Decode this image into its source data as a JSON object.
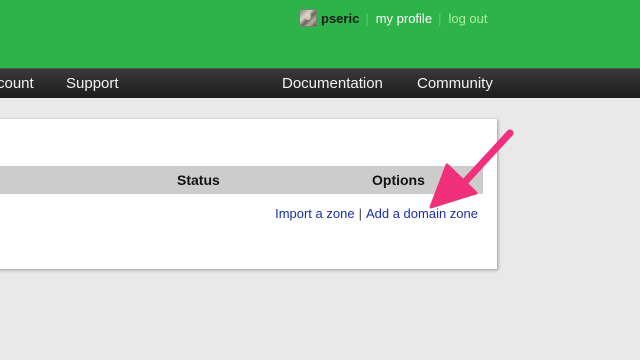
{
  "header": {
    "username": "pseric",
    "links": {
      "profile": "my profile",
      "logout": "log out"
    }
  },
  "nav": {
    "items": [
      "count",
      "Support",
      "Documentation",
      "Community"
    ]
  },
  "table": {
    "headers": {
      "status": "Status",
      "options": "Options"
    },
    "actions": {
      "import": "Import a zone",
      "separator": "|",
      "add": "Add a domain zone"
    }
  },
  "colors": {
    "brand_green": "#2db34a",
    "nav_dark": "#222222",
    "arrow": "#f0307a",
    "link": "#1a2ea8"
  }
}
